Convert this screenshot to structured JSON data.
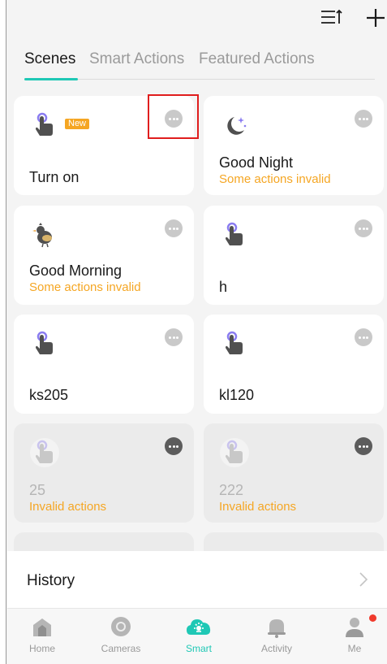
{
  "tabs": [
    {
      "label": "Scenes"
    },
    {
      "label": "Smart Actions"
    },
    {
      "label": "Featured Actions"
    }
  ],
  "cards": [
    {
      "name": "Turn on",
      "sub": "",
      "badge": "New",
      "icon": "hand-tap-icon"
    },
    {
      "name": "Good Night",
      "sub": "Some actions invalid",
      "icon": "moon-icon"
    },
    {
      "name": "Good Morning",
      "sub": "Some actions invalid",
      "icon": "bird-icon"
    },
    {
      "name": "h",
      "sub": "",
      "icon": "hand-tap-icon"
    },
    {
      "name": "ks205",
      "sub": "",
      "icon": "hand-tap-icon"
    },
    {
      "name": "kl120",
      "sub": "",
      "icon": "hand-tap-icon"
    },
    {
      "name": "25",
      "sub": "Invalid actions",
      "icon": "hand-tap-icon"
    },
    {
      "name": "222",
      "sub": "Invalid actions",
      "icon": "hand-tap-icon"
    }
  ],
  "history": {
    "label": "History"
  },
  "nav": [
    {
      "label": "Home",
      "icon": "home-icon"
    },
    {
      "label": "Cameras",
      "icon": "camera-icon"
    },
    {
      "label": "Smart",
      "icon": "smart-icon"
    },
    {
      "label": "Activity",
      "icon": "bell-icon"
    },
    {
      "label": "Me",
      "icon": "person-icon"
    }
  ],
  "colors": {
    "accent": "#1fc8b5",
    "warning": "#f5a623",
    "highlight": "#e01e1e",
    "notification": "#f03a2c"
  }
}
